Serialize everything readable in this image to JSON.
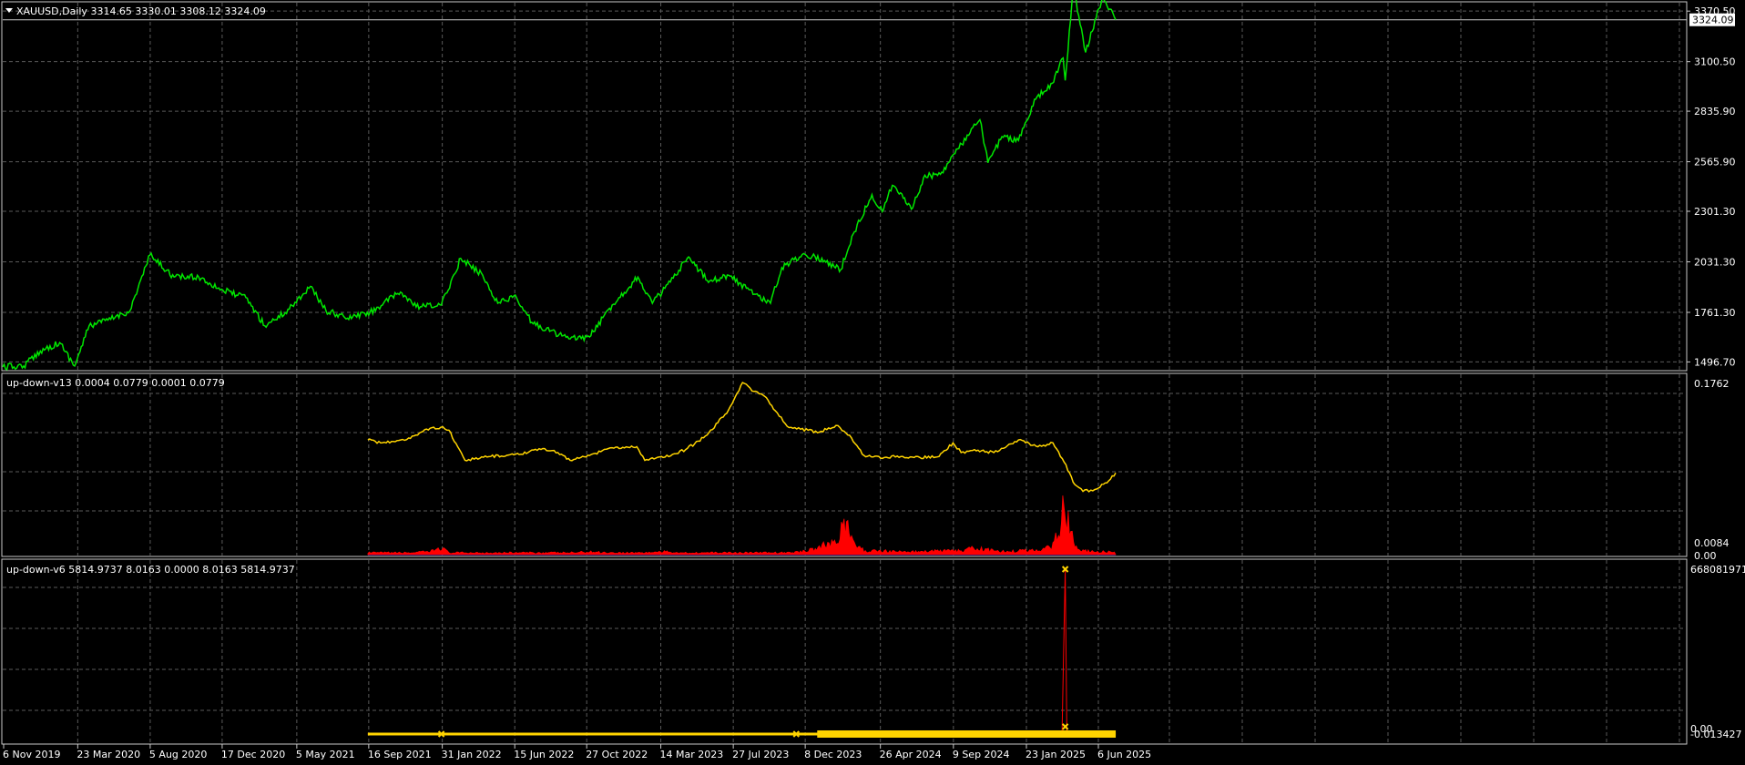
{
  "colors": {
    "background": "#000000",
    "frame": "#c8c8c8",
    "grid": "#5a5a5a",
    "text": "#ffffff",
    "price_line": "#00e600",
    "indicator_line": "#ffd400",
    "histogram": "#ff0000",
    "baseline": "#2a2aff",
    "cross_marker": "#ffd400",
    "spike_line": "#ff0000",
    "current_price_bg": "#ffffff",
    "current_price_text": "#000000"
  },
  "main_panel": {
    "header": "XAUUSD,Daily  3314.65 3330.01 3308.12 3324.09",
    "collapse_icon": "triangle-down-icon",
    "y_labels": [
      "3370.50",
      "3100.50",
      "2835.90",
      "2565.90",
      "2301.30",
      "2031.30",
      "1761.30",
      "1496.70"
    ],
    "current_price": "3324.09"
  },
  "indicator1": {
    "header": "up-down-v13 0.0004 0.0779 0.0001 0.0779",
    "y_labels": [
      "0.1762",
      "0.0084",
      "0.00"
    ]
  },
  "indicator2": {
    "header": "up-down-v6 5814.9737 8.0163 0.0000 8.0163 5814.9737",
    "y_labels": [
      "668081971",
      "0.00",
      "-0.013427"
    ]
  },
  "x_labels": [
    "6 Nov 2019",
    "23 Mar 2020",
    "5 Aug 2020",
    "17 Dec 2020",
    "5 May 2021",
    "16 Sep 2021",
    "31 Jan 2022",
    "15 Jun 2022",
    "27 Oct 2022",
    "14 Mar 2023",
    "27 Jul 2023",
    "8 Dec 2023",
    "26 Apr 2024",
    "9 Sep 2024",
    "23 Jan 2025",
    "6 Jun 2025"
  ],
  "chart_data": [
    {
      "type": "line",
      "title": "XAUUSD,Daily",
      "x": [
        "2019-11-06",
        "2019-12-15",
        "2020-01-15",
        "2020-02-20",
        "2020-03-19",
        "2020-04-15",
        "2020-05-20",
        "2020-06-30",
        "2020-08-06",
        "2020-09-20",
        "2020-11-05",
        "2020-12-20",
        "2021-02-01",
        "2021-03-08",
        "2021-04-15",
        "2021-06-01",
        "2021-06-30",
        "2021-08-09",
        "2021-09-20",
        "2021-11-16",
        "2021-12-15",
        "2022-01-31",
        "2022-03-08",
        "2022-04-18",
        "2022-05-16",
        "2022-06-15",
        "2022-07-21",
        "2022-09-28",
        "2022-11-03",
        "2022-12-15",
        "2023-02-01",
        "2023-02-28",
        "2023-04-13",
        "2023-05-04",
        "2023-06-15",
        "2023-07-20",
        "2023-08-22",
        "2023-10-06",
        "2023-10-27",
        "2023-12-04",
        "2023-12-28",
        "2024-02-14",
        "2024-03-08",
        "2024-04-12",
        "2024-05-01",
        "2024-05-20",
        "2024-06-27",
        "2024-07-17",
        "2024-08-20",
        "2024-09-26",
        "2024-10-30",
        "2024-11-14",
        "2024-12-10",
        "2025-01-10",
        "2025-02-11",
        "2025-03-14",
        "2025-04-03",
        "2025-04-07",
        "2025-04-22",
        "2025-05-15",
        "2025-06-16",
        "2025-07-10"
      ],
      "series": [
        {
          "values": [
            1470,
            1475,
            1555,
            1600,
            1475,
            1690,
            1720,
            1770,
            2067,
            1950,
            1950,
            1880,
            1840,
            1690,
            1760,
            1900,
            1770,
            1730,
            1760,
            1870,
            1790,
            1800,
            2050,
            1960,
            1810,
            1850,
            1700,
            1620,
            1630,
            1800,
            1950,
            1810,
            1960,
            2050,
            1930,
            1960,
            1890,
            1810,
            2000,
            2070,
            2060,
            1990,
            2180,
            2390,
            2300,
            2440,
            2320,
            2480,
            2510,
            2660,
            2790,
            2560,
            2700,
            2680,
            2900,
            2985,
            3120,
            3000,
            3500,
            3150,
            3450,
            3324
          ]
        }
      ],
      "ylim": [
        1450,
        3420
      ]
    },
    {
      "type": "line",
      "title": "up-down-v13",
      "x": [
        "2021-09-16",
        "2021-10-10",
        "2021-11-16",
        "2021-12-01",
        "2022-01-10",
        "2022-01-30",
        "2022-02-14",
        "2022-03-16",
        "2022-05-03",
        "2022-06-25",
        "2022-08-01",
        "2022-09-05",
        "2022-09-28",
        "2022-11-03",
        "2022-12-15",
        "2023-01-30",
        "2023-02-14",
        "2023-03-20",
        "2023-05-01",
        "2023-06-10",
        "2023-07-20",
        "2023-08-15",
        "2023-09-05",
        "2023-09-25",
        "2023-10-15",
        "2023-11-06",
        "2023-12-01",
        "2024-01-05",
        "2024-02-05",
        "2024-02-20",
        "2024-03-05",
        "2024-03-28",
        "2024-05-05",
        "2024-06-05",
        "2024-07-10",
        "2024-08-15",
        "2024-09-10",
        "2024-09-25",
        "2024-10-20",
        "2024-11-25",
        "2024-12-20",
        "2025-01-10",
        "2025-02-15",
        "2025-03-15",
        "2025-04-05",
        "2025-04-25",
        "2025-05-10",
        "2025-06-01",
        "2025-06-27",
        "2025-07-10"
      ],
      "series": [
        {
          "name": "line",
          "values": [
            0.118,
            0.115,
            0.118,
            0.12,
            0.13,
            0.131,
            0.128,
            0.097,
            0.101,
            0.103,
            0.109,
            0.105,
            0.097,
            0.102,
            0.11,
            0.111,
            0.097,
            0.1,
            0.108,
            0.123,
            0.149,
            0.177,
            0.168,
            0.163,
            0.148,
            0.132,
            0.129,
            0.126,
            0.133,
            0.127,
            0.12,
            0.102,
            0.1,
            0.101,
            0.1,
            0.101,
            0.115,
            0.105,
            0.108,
            0.105,
            0.112,
            0.118,
            0.111,
            0.115,
            0.095,
            0.072,
            0.065,
            0.067,
            0.076,
            0.084
          ]
        },
        {
          "name": "histogram",
          "values": [
            0.002,
            0.002,
            0.002,
            0.002,
            0.003,
            0.008,
            0.002,
            0.002,
            0.002,
            0.002,
            0.002,
            0.002,
            0.002,
            0.003,
            0.002,
            0.002,
            0.002,
            0.003,
            0.002,
            0.002,
            0.002,
            0.002,
            0.002,
            0.002,
            0.002,
            0.002,
            0.003,
            0.008,
            0.015,
            0.038,
            0.015,
            0.004,
            0.004,
            0.003,
            0.003,
            0.004,
            0.004,
            0.004,
            0.007,
            0.004,
            0.003,
            0.004,
            0.005,
            0.01,
            0.054,
            0.01,
            0.004,
            0.003,
            0.003,
            0.002
          ]
        }
      ],
      "ylim": [
        -0.001,
        0.1762
      ]
    },
    {
      "type": "line",
      "title": "up-down-v6",
      "x": [
        "2021-09-16",
        "2022-01-31",
        "2023-12-01",
        "2024-01-01",
        "2024-07-01",
        "2025-04-01",
        "2025-04-07",
        "2025-04-10",
        "2025-05-01",
        "2025-07-10"
      ],
      "series": [
        {
          "name": "values",
          "values": [
            0,
            0,
            0,
            0,
            0,
            0,
            668081971,
            0,
            0,
            0
          ]
        }
      ],
      "markers": [
        {
          "x": "2022-01-31",
          "y": 0
        },
        {
          "x": "2023-11-23",
          "y": 0
        },
        {
          "x": "2025-04-07",
          "y": 668081971
        },
        {
          "x": "2025-04-07",
          "y": 30000000
        }
      ],
      "ylim": [
        -13427,
        668081971
      ]
    }
  ]
}
